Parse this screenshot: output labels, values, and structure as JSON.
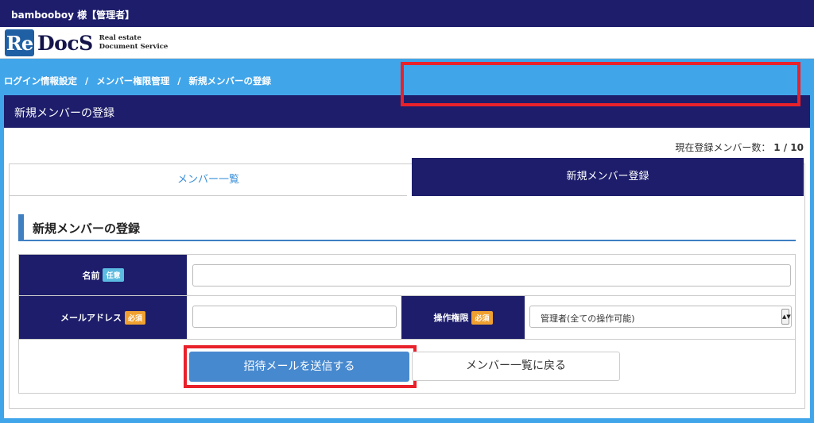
{
  "topbar": {
    "user_label": "bambooboy 様【管理者】"
  },
  "logo": {
    "re": "Re",
    "docs": "DocS",
    "sub_line1": "Real estate",
    "sub_line2": "Document Service"
  },
  "breadcrumb": [
    "ログイン情報設定",
    "メンバー権限管理",
    "新規メンバーの登録"
  ],
  "breadcrumb_sep": "/",
  "panel": {
    "title": "新規メンバーの登録"
  },
  "member_count": {
    "label": "現在登録メンバー数：",
    "value": "1 / 10"
  },
  "tabs": [
    {
      "label": "メンバー一覧",
      "active": false
    },
    {
      "label": "新規メンバー登録",
      "active": true
    }
  ],
  "section": {
    "title": "新規メンバーの登録"
  },
  "form": {
    "name": {
      "label": "名前",
      "badge": "任意",
      "value": ""
    },
    "email": {
      "label": "メールアドレス",
      "badge": "必須",
      "value": ""
    },
    "permission": {
      "label": "操作権限",
      "badge": "必須",
      "selected": "管理者(全ての操作可能)"
    }
  },
  "buttons": {
    "send": "招待メールを送信する",
    "back": "メンバー一覧に戻る"
  },
  "colors": {
    "navy": "#1d1d6b",
    "sky": "#41a5e9",
    "highlight": "#e8212a",
    "primary_button": "#4789cf"
  }
}
